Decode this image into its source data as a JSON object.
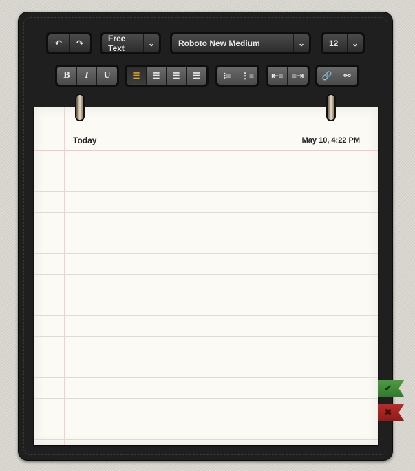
{
  "toolbar": {
    "undo_icon": "undo-icon",
    "redo_icon": "redo-icon",
    "mode": "Free Text",
    "font": "Roboto New Medium",
    "size": "12",
    "bold": "B",
    "italic": "I",
    "underline": "U",
    "align_active": "left"
  },
  "note": {
    "title": "Today",
    "date": "May 10, 4:22 PM"
  },
  "actions": {
    "confirm_icon": "✔",
    "cancel_icon": "✖",
    "confirm_color": "#3f8a35",
    "cancel_color": "#a8221f"
  },
  "colors": {
    "accent": "#d9a022"
  }
}
